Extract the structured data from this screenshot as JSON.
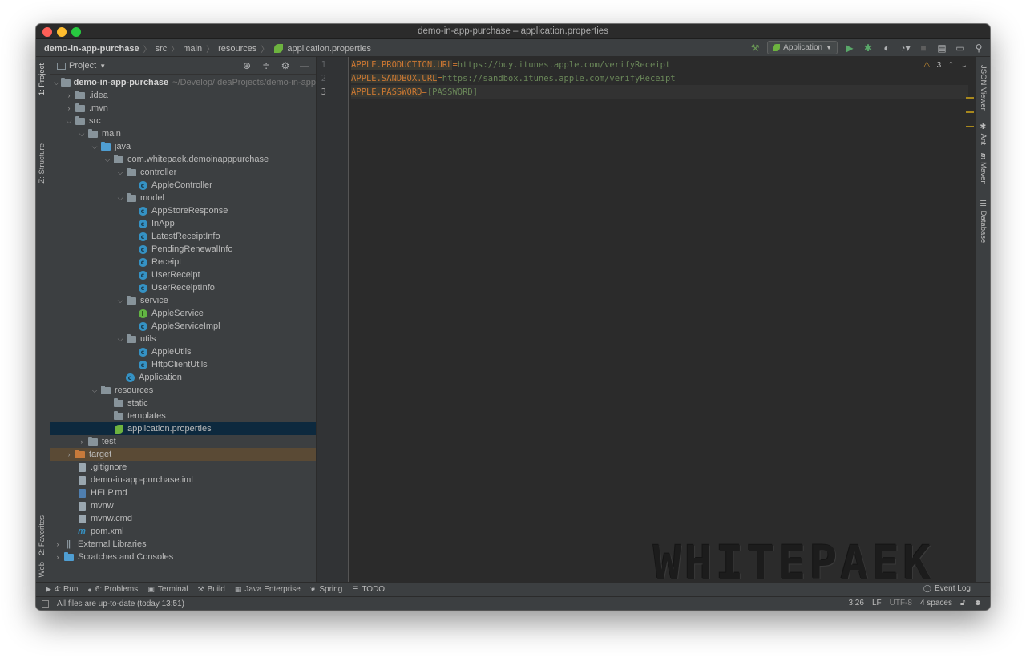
{
  "window": {
    "title": "demo-in-app-purchase – application.properties"
  },
  "breadcrumb": [
    "demo-in-app-purchase",
    "src",
    "main",
    "resources",
    "application.properties"
  ],
  "toolbar": {
    "run_config": "Application"
  },
  "left_strip": {
    "project": "1: Project",
    "structure": "Z: Structure",
    "favorites": "2: Favorites",
    "web": "Web"
  },
  "right_strip": {
    "json_viewer": "JSON Viewer",
    "ant": "Ant",
    "maven": "Maven",
    "database": "Database"
  },
  "project_panel": {
    "title": "Project"
  },
  "tree": {
    "root": "demo-in-app-purchase",
    "root_path": "~/Develop/IdeaProjects/demo-in-app",
    "idea": ".idea",
    "mvn": ".mvn",
    "src": "src",
    "main": "main",
    "java": "java",
    "package": "com.whitepaek.demoinapppurchase",
    "controller": "controller",
    "apple_controller": "AppleController",
    "model": "model",
    "app_store_response": "AppStoreResponse",
    "in_app": "InApp",
    "latest_receipt_info": "LatestReceiptInfo",
    "pending_renewal_info": "PendingRenewalInfo",
    "receipt": "Receipt",
    "user_receipt": "UserReceipt",
    "user_receipt_info": "UserReceiptInfo",
    "service": "service",
    "apple_service": "AppleService",
    "apple_service_impl": "AppleServiceImpl",
    "utils": "utils",
    "apple_utils": "AppleUtils",
    "http_client_utils": "HttpClientUtils",
    "application": "Application",
    "resources": "resources",
    "static": "static",
    "templates": "templates",
    "application_properties": "application.properties",
    "test": "test",
    "target": "target",
    "gitignore": ".gitignore",
    "iml": "demo-in-app-purchase.iml",
    "help": "HELP.md",
    "mvnw": "mvnw",
    "mvnw_cmd": "mvnw.cmd",
    "pom": "pom.xml",
    "external_libraries": "External Libraries",
    "scratches": "Scratches and Consoles"
  },
  "editor": {
    "line_numbers": [
      "1",
      "2",
      "3"
    ],
    "lines": [
      {
        "key": "APPLE.PRODUCTION.URL",
        "sep": "=",
        "value": "https://buy.itunes.apple.com/verifyReceipt"
      },
      {
        "key": "APPLE.SANDBOX.URL",
        "sep": "=",
        "value": "https://sandbox.itunes.apple.com/verifyReceipt"
      },
      {
        "key": "APPLE.PASSWORD",
        "sep": "=",
        "value": "[PASSWORD]"
      }
    ],
    "warning_count": "3",
    "watermark": "WHITEPAEK"
  },
  "bottom_tools": {
    "run": "4: Run",
    "problems": "6: Problems",
    "terminal": "Terminal",
    "build": "Build",
    "java_enterprise": "Java Enterprise",
    "spring": "Spring",
    "todo": "TODO",
    "event_log": "Event Log"
  },
  "status": {
    "message": "All files are up-to-date (today 13:51)",
    "position": "3:26",
    "line_sep": "LF",
    "encoding": "UTF-8",
    "indent": "4 spaces"
  },
  "colors": {
    "selection": "#0d293e",
    "key": "#cc7832",
    "value": "#6a8759",
    "background": "#2b2b2b"
  }
}
